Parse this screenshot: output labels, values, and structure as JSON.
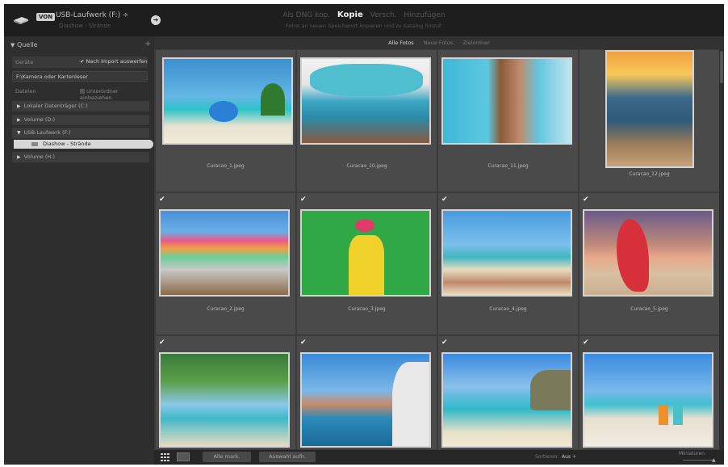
{
  "topbar": {
    "source_badge": "VON",
    "drive_name": "USB-Laufwerk (F:)",
    "drive_caret": "÷",
    "drive_path": "Diashow - Strände",
    "arrow": "➔",
    "modes": [
      "Als DNG kop.",
      "Kopie",
      "Versch.",
      "Hinzufügen"
    ],
    "mode_desc": "Fotos an neuen Speicherort kopieren und zu Katalog hinzuf."
  },
  "left_panel": {
    "section_title": "Quelle",
    "section_arrow": "▼",
    "add_symbol": "+",
    "device_label": "Geräte",
    "eject_label": "Nach Import auswerfen",
    "device_input": "F:\\Kamera oder Kartenleser",
    "files_label": "Dateien",
    "subfolders_label": "Unterordner einbeziehen",
    "volumes": [
      {
        "label": "Lokaler Datenträger (C:)",
        "expanded": false
      },
      {
        "label": "Volume (D:)",
        "expanded": false
      },
      {
        "label": "USB-Laufwerk (F:)",
        "expanded": true
      },
      {
        "label": "Volume (H:)",
        "expanded": false
      }
    ],
    "selected_folder": "Diashow - Strände"
  },
  "filter_tabs": [
    "Alle Fotos",
    "Neue Fotos",
    "Zielordner"
  ],
  "thumbnails": [
    {
      "file": "Curacao_1.jpeg",
      "checked": true
    },
    {
      "file": "Curacao_10.jpeg",
      "checked": true
    },
    {
      "file": "Curacao_11.jpeg",
      "checked": true
    },
    {
      "file": "Curacao_12.jpeg",
      "checked": true
    },
    {
      "file": "Curacao_2.jpeg",
      "checked": true
    },
    {
      "file": "Curacao_3.jpeg",
      "checked": true
    },
    {
      "file": "Curacao_4.jpeg",
      "checked": true
    },
    {
      "file": "Curacao_5.jpeg",
      "checked": true
    },
    {
      "file": "",
      "checked": true
    },
    {
      "file": "",
      "checked": true
    },
    {
      "file": "",
      "checked": true
    },
    {
      "file": "",
      "checked": true
    }
  ],
  "bottom": {
    "check_all": "Alle mark.",
    "uncheck_all": "Auswahl aufh.",
    "sort_label": "Sortieren:",
    "sort_value": "Aus ÷",
    "thumb_label": "Miniaturen"
  },
  "colors": {
    "panel_bg": "#2e2e2e",
    "grid_bg": "#3b3b3b",
    "cell_bg": "#4a4a4a",
    "selected_row": "#d8d8d8"
  }
}
